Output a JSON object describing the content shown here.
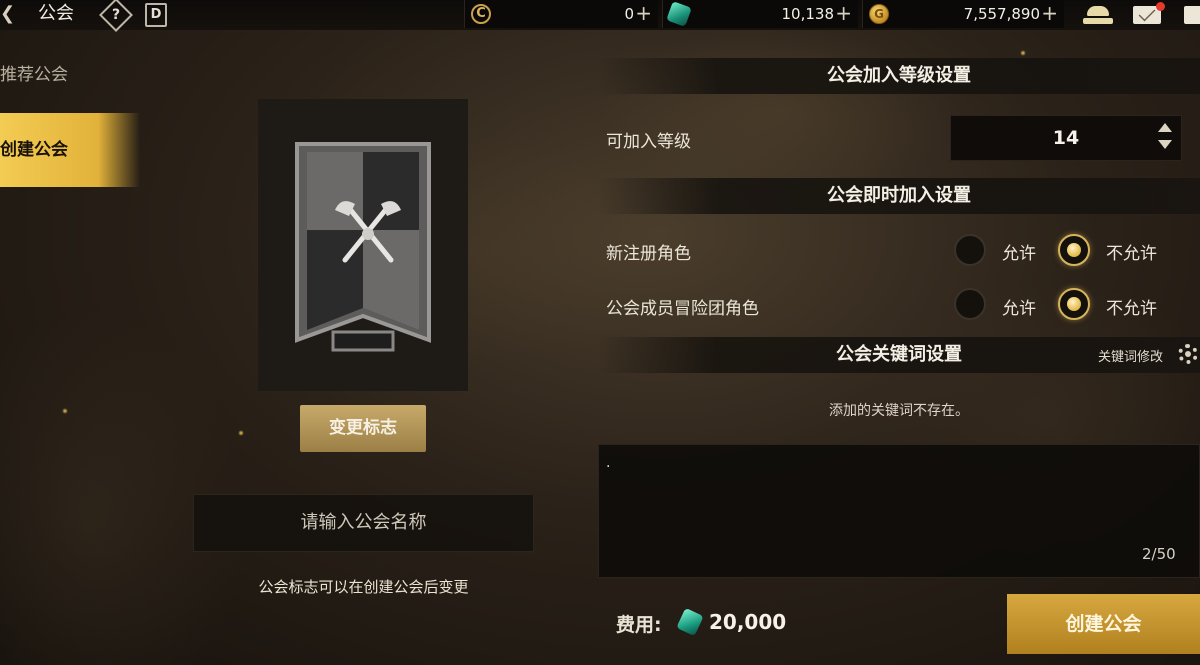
{
  "topbar": {
    "title": "公会",
    "help_icon_label": "?",
    "calendar_icon_label": "D",
    "currency_coin_value": "0",
    "currency_gem_value": "10,138",
    "currency_gold_value": "7,557,890",
    "coin_icon_label": "C",
    "gold_icon_label": "G"
  },
  "sidebar": {
    "items": [
      {
        "label": "推荐公会",
        "active": false
      },
      {
        "label": "创建公会",
        "active": true
      }
    ]
  },
  "emblem": {
    "change_button": "变更标志",
    "name_placeholder": "请输入公会名称",
    "hint": "公会标志可以在创建公会后变更"
  },
  "settings": {
    "level_section": "公会加入等级设置",
    "level_label": "可加入等级",
    "level_value": "14",
    "instant_section": "公会即时加入设置",
    "rows": [
      {
        "label": "新注册角色",
        "allow": "允许",
        "deny": "不允许",
        "selected": "deny"
      },
      {
        "label": "公会成员冒险团角色",
        "allow": "允许",
        "deny": "不允许",
        "selected": "deny"
      }
    ],
    "keyword_section": "公会关键词设置",
    "keyword_edit": "关键词修改",
    "keyword_empty": "添加的关键词不存在。",
    "keyword_text": ".",
    "keyword_count": "2/50"
  },
  "footer": {
    "cost_label": "费用:",
    "cost_value": "20,000",
    "create_button": "创建公会"
  },
  "colors": {
    "accent_gold": "#e2b23a",
    "button_gold": "#b0801f",
    "gem_green": "#1a9a7f"
  }
}
